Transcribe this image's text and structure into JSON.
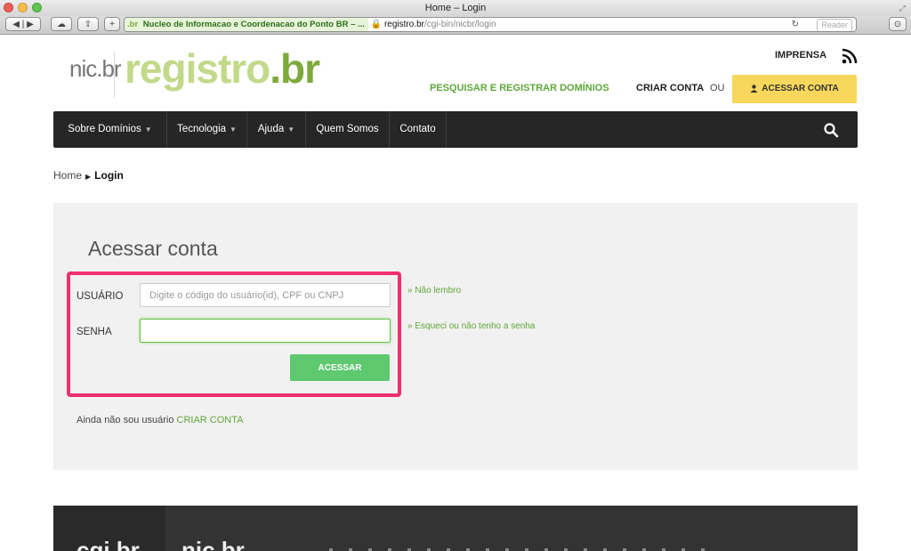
{
  "browser": {
    "window_title": "Home – Login",
    "site_label": "Nucleo de Informacao e Coordenacao do Ponto BR – ...",
    "url_host": "registro.br",
    "url_path": "/cgi-bin/nicbr/login",
    "reader_label": "Reader",
    "favicon_text": ".br"
  },
  "header": {
    "logo_nic": "nic.br",
    "logo_registro": "registro",
    "logo_br": ".br",
    "imprensa": "IMPRENSA",
    "pesquisar": "PESQUISAR E REGISTRAR DOMÍNIOS",
    "criar_conta": "CRIAR CONTA",
    "ou": "OU",
    "acessar_conta": "ACESSAR CONTA"
  },
  "nav": {
    "items": [
      {
        "label": "Sobre Domínios",
        "dropdown": true
      },
      {
        "label": "Tecnologia",
        "dropdown": true
      },
      {
        "label": "Ajuda",
        "dropdown": true
      },
      {
        "label": "Quem Somos",
        "dropdown": false
      },
      {
        "label": "Contato",
        "dropdown": false
      }
    ]
  },
  "breadcrumb": {
    "home": "Home",
    "current": "Login"
  },
  "login": {
    "title": "Acessar conta",
    "usuario_label": "USUÁRIO",
    "usuario_placeholder": "Digite o código do usuário(id), CPF ou CNPJ",
    "senha_label": "SENHA",
    "senha_value": "",
    "nao_lembro": "» Não lembro",
    "esqueci": "» Esqueci ou não tenho a senha",
    "submit": "ACESSAR",
    "ainda_text": "Ainda não sou usuário",
    "criar_conta_link": "CRIAR CONTA"
  },
  "footer": {
    "cgi": "cgi.br",
    "nic": "nic.br"
  },
  "colors": {
    "accent_green": "#5ea838",
    "button_green": "#5ec96f",
    "yellow": "#f7d85c",
    "highlight": "#f0306e",
    "nav_bg": "#262626"
  }
}
